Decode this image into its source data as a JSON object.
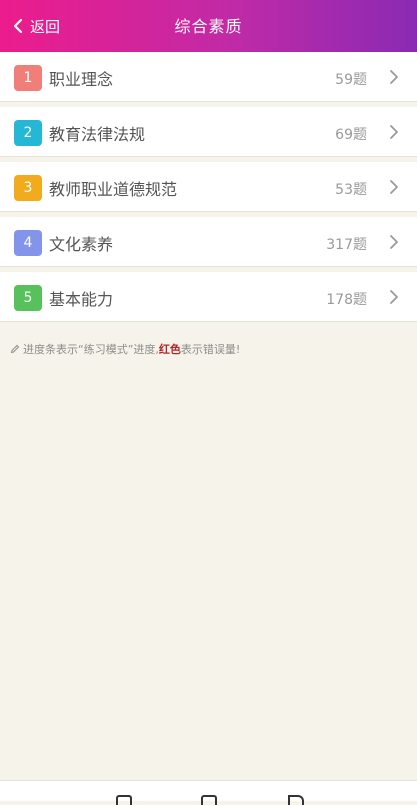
{
  "header": {
    "back_label": "返回",
    "title": "综合素质"
  },
  "items": [
    {
      "num": "1",
      "label": "职业理念",
      "count": "59题",
      "color": "#f07f7a"
    },
    {
      "num": "2",
      "label": "教育法律法规",
      "count": "69题",
      "color": "#25b8d6"
    },
    {
      "num": "3",
      "label": "教师职业道德规范",
      "count": "53题",
      "color": "#f2ab1c"
    },
    {
      "num": "4",
      "label": "文化素养",
      "count": "317题",
      "color": "#8395ea"
    },
    {
      "num": "5",
      "label": "基本能力",
      "count": "178题",
      "color": "#57c15b"
    }
  ],
  "hint": {
    "prefix": "进度条表示“练习模式”进度,",
    "highlight": "红色",
    "suffix": "表示错误量!"
  },
  "colors": {
    "header_start": "#ec1c8c",
    "header_end": "#8a2ab4",
    "highlight_red": "#b4262a"
  }
}
